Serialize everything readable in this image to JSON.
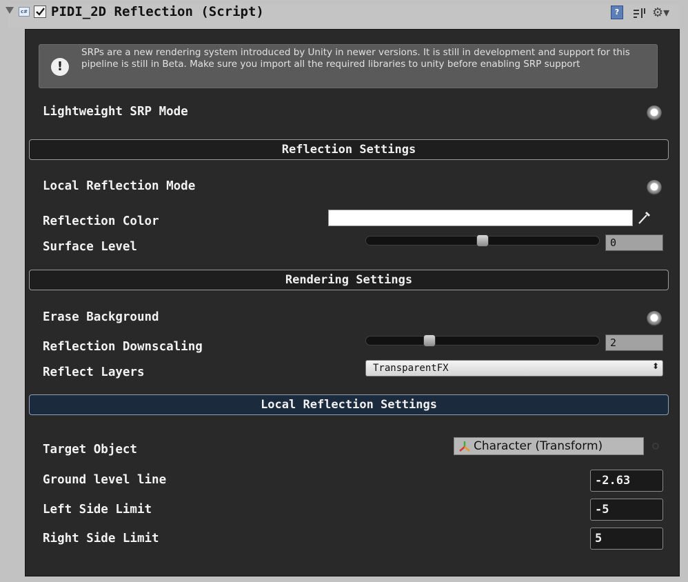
{
  "component": {
    "title": "PIDI_2D Reflection (Script)",
    "enabled": true,
    "script_icon_text": "c#",
    "icons": [
      "foldout-arrow-icon",
      "script-icon",
      "help-icon",
      "preset-icon",
      "gear-icon"
    ]
  },
  "help_box": {
    "text": "SRPs are a new rendering system introduced by Unity in newer versions. It is still in development and support for this pipeline is still in Beta. Make sure you import all the required libraries to unity before enabling SRP support",
    "icon": "warning-icon"
  },
  "fields": {
    "lightweight_srp_mode": "Lightweight SRP Mode",
    "local_reflection_mode": "Local Reflection Mode",
    "reflection_color": "Reflection Color",
    "reflection_color_value": "#FFFFFF",
    "surface_level": "Surface Level",
    "surface_level_value": "0",
    "surface_level_fraction": 0.5,
    "erase_background": "Erase Background",
    "reflection_downscaling": "Reflection Downscaling",
    "reflection_downscaling_value": "2",
    "reflection_downscaling_fraction": 0.26,
    "reflect_layers": "Reflect Layers",
    "reflect_layers_value": "TransparentFX",
    "target_object": "Target Object",
    "target_object_value": "Character (Transform)",
    "ground_level_line": "Ground level line",
    "ground_level_line_value": "-2.63",
    "left_side_limit": "Left Side Limit",
    "left_side_limit_value": "-5",
    "right_side_limit": "Right Side Limit",
    "right_side_limit_value": "5"
  },
  "sections": {
    "reflection_settings": "Reflection Settings",
    "rendering_settings": "Rendering Settings",
    "local_reflection_settings": "Local Reflection Settings"
  },
  "colors": {
    "panel_bg": "#292929",
    "section_blue": "#1b2a3d"
  }
}
